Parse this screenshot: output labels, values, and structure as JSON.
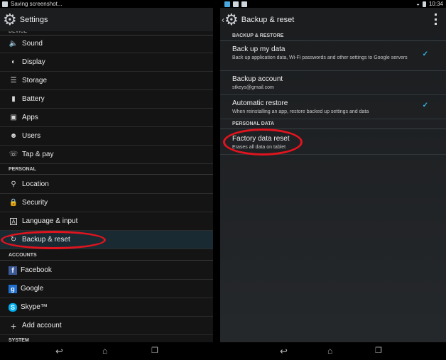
{
  "left": {
    "status": {
      "text": "Saving screenshot..."
    },
    "actionbar": {
      "title": "Settings"
    },
    "top_partial_section": "DEVICE",
    "items": [
      {
        "label": "Sound",
        "icon": "speaker-icon",
        "glyph": "🔈"
      },
      {
        "label": "Display",
        "icon": "display-icon",
        "glyph": "◐"
      },
      {
        "label": "Storage",
        "icon": "storage-icon",
        "glyph": "☰"
      },
      {
        "label": "Battery",
        "icon": "battery-icon",
        "glyph": "▮"
      },
      {
        "label": "Apps",
        "icon": "apps-icon",
        "glyph": "▣"
      },
      {
        "label": "Users",
        "icon": "users-icon",
        "glyph": "☻"
      },
      {
        "label": "Tap & pay",
        "icon": "tap-pay-icon",
        "glyph": "☏"
      }
    ],
    "personal_header": "PERSONAL",
    "personal_items": [
      {
        "label": "Location",
        "icon": "location-icon",
        "glyph": "⚲"
      },
      {
        "label": "Security",
        "icon": "lock-icon",
        "glyph": "🔒"
      },
      {
        "label": "Language & input",
        "icon": "language-icon",
        "glyph": "A"
      },
      {
        "label": "Backup & reset",
        "icon": "backup-icon",
        "glyph": "↻"
      }
    ],
    "accounts_header": "ACCOUNTS",
    "account_items": [
      {
        "label": "Facebook",
        "icon": "facebook-icon",
        "glyph": "f"
      },
      {
        "label": "Google",
        "icon": "google-icon",
        "glyph": "g"
      },
      {
        "label": "Skype™",
        "icon": "skype-icon",
        "glyph": "S"
      },
      {
        "label": "Add account",
        "icon": "plus-icon",
        "glyph": "+"
      }
    ],
    "bottom_partial_section": "SYSTEM"
  },
  "right": {
    "status": {
      "time": "10:34"
    },
    "actionbar": {
      "title": "Backup & reset"
    },
    "backup_header": "BACKUP & RESTORE",
    "backup_items": [
      {
        "title": "Back up my data",
        "subtitle": "Back up application data, Wi-Fi passwords and other settings to Google servers",
        "checked": true
      },
      {
        "title": "Backup account",
        "subtitle": "stkeys@gmail.com",
        "checked": false
      },
      {
        "title": "Automatic restore",
        "subtitle": "When reinstalling an app, restore backed up settings and data",
        "checked": true
      }
    ],
    "personal_header": "PERSONAL DATA",
    "factory": {
      "title": "Factory data reset",
      "subtitle": "Erases all data on tablet"
    }
  },
  "colors": {
    "accent": "#33b5e5",
    "highlight": "#e0141e"
  },
  "nav_icons": [
    "back-icon",
    "home-icon",
    "recents-icon"
  ]
}
